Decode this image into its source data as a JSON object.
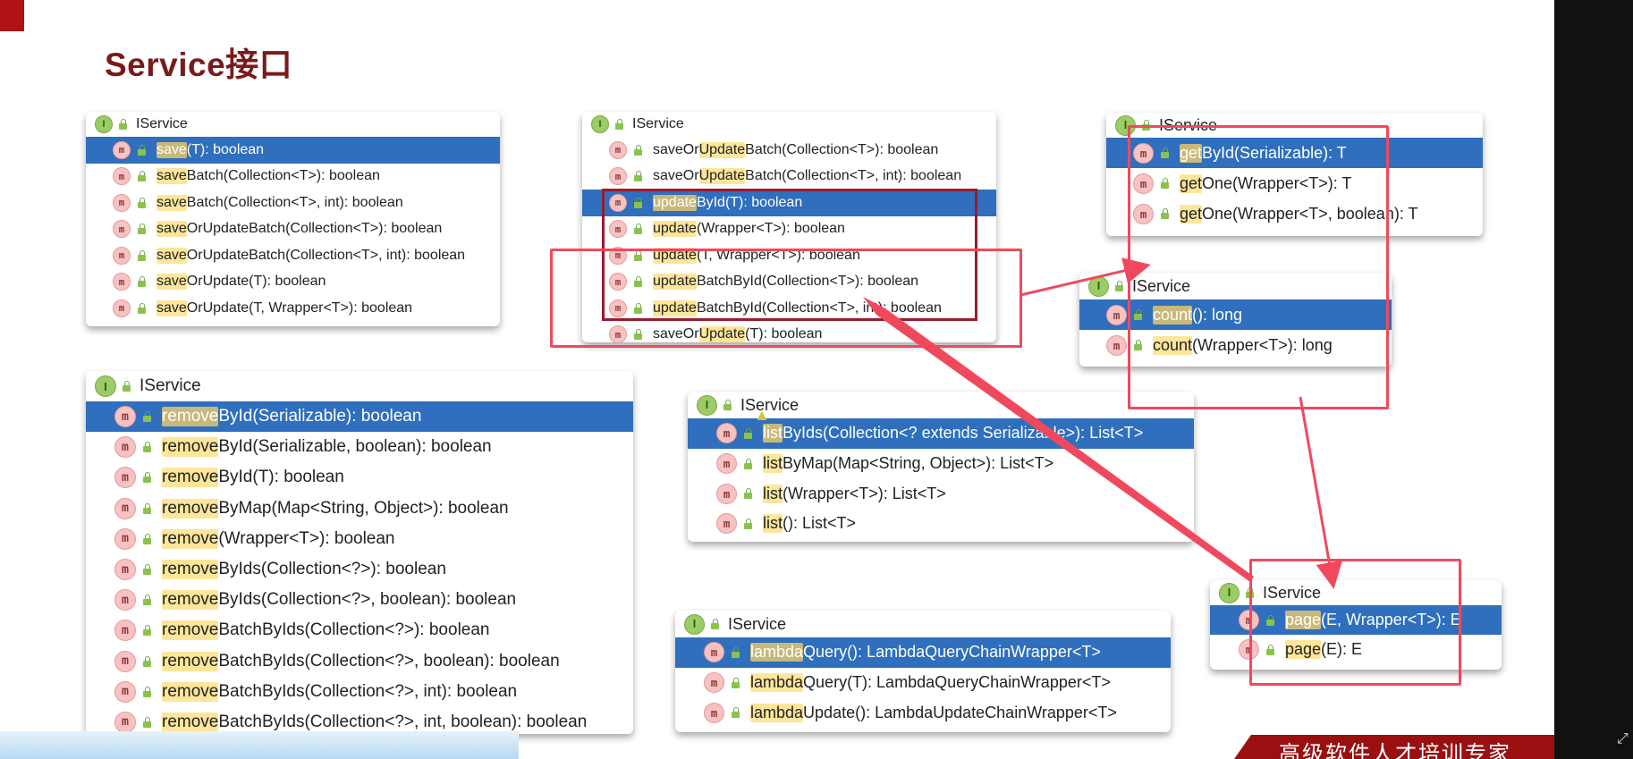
{
  "slide": {
    "title": "Service接口",
    "footer_text": "高级软件人才培训专家"
  },
  "panels": {
    "save": {
      "header": "IService",
      "rows": [
        {
          "hl": "save",
          "rest": "(T): boolean",
          "selected": true
        },
        {
          "hl": "save",
          "rest": "Batch(Collection<T>): boolean"
        },
        {
          "hl": "save",
          "rest": "Batch(Collection<T>, int): boolean"
        },
        {
          "hl": "save",
          "rest": "OrUpdateBatch(Collection<T>): boolean"
        },
        {
          "hl": "save",
          "rest": "OrUpdateBatch(Collection<T>, int): boolean"
        },
        {
          "hl": "save",
          "rest": "OrUpdate(T): boolean"
        },
        {
          "hl": "save",
          "rest": "OrUpdate(T, Wrapper<T>): boolean"
        }
      ]
    },
    "update": {
      "header": "IService",
      "rows": [
        {
          "pre": "saveOr",
          "hl": "Update",
          "rest": "Batch(Collection<T>): boolean"
        },
        {
          "pre": "saveOr",
          "hl": "Update",
          "rest": "Batch(Collection<T>, int): boolean"
        },
        {
          "pre": "",
          "hl": "update",
          "rest": "ById(T): boolean",
          "selected": true
        },
        {
          "pre": "",
          "hl": "update",
          "rest": "(Wrapper<T>): boolean"
        },
        {
          "pre": "",
          "hl": "update",
          "rest": "(T, Wrapper<T>): boolean"
        },
        {
          "pre": "",
          "hl": "update",
          "rest": "BatchById(Collection<T>): boolean"
        },
        {
          "pre": "",
          "hl": "update",
          "rest": "BatchById(Collection<T>, int): boolean"
        },
        {
          "pre": "saveOr",
          "hl": "Update",
          "rest": "(T): boolean"
        }
      ]
    },
    "get": {
      "header": "IService",
      "rows": [
        {
          "hl": "get",
          "rest": "ById(Serializable): T",
          "selected": true
        },
        {
          "hl": "get",
          "rest": "One(Wrapper<T>): T"
        },
        {
          "hl": "get",
          "rest": "One(Wrapper<T>, boolean): T"
        }
      ]
    },
    "count": {
      "header": "IService",
      "rows": [
        {
          "hl": "count",
          "rest": "(): long",
          "selected": true
        },
        {
          "hl": "count",
          "rest": "(Wrapper<T>): long"
        }
      ]
    },
    "remove": {
      "header": "IService",
      "rows": [
        {
          "hl": "remove",
          "rest": "ById(Serializable): boolean",
          "selected": true
        },
        {
          "hl": "remove",
          "rest": "ById(Serializable, boolean): boolean"
        },
        {
          "hl": "remove",
          "rest": "ById(T): boolean"
        },
        {
          "hl": "remove",
          "rest": "ByMap(Map<String, Object>): boolean"
        },
        {
          "hl": "remove",
          "rest": "(Wrapper<T>): boolean"
        },
        {
          "hl": "remove",
          "rest": "ByIds(Collection<?>): boolean"
        },
        {
          "hl": "remove",
          "rest": "ByIds(Collection<?>, boolean): boolean"
        },
        {
          "hl": "remove",
          "rest": "BatchByIds(Collection<?>): boolean"
        },
        {
          "hl": "remove",
          "rest": "BatchByIds(Collection<?>, boolean): boolean"
        },
        {
          "hl": "remove",
          "rest": "BatchByIds(Collection<?>, int): boolean"
        },
        {
          "hl": "remove",
          "rest": "BatchByIds(Collection<?>, int, boolean): boolean"
        }
      ]
    },
    "list": {
      "header": "IService",
      "rows": [
        {
          "hl": "list",
          "rest": "ByIds(Collection<? extends Serializable>): List<T>",
          "selected": true
        },
        {
          "hl": "list",
          "rest": "ByMap(Map<String, Object>): List<T>"
        },
        {
          "hl": "list",
          "rest": "(Wrapper<T>): List<T>"
        },
        {
          "hl": "list",
          "rest": "(): List<T>"
        }
      ]
    },
    "lambda": {
      "header": "IService",
      "rows": [
        {
          "hl": "lambda",
          "rest": "Query(): LambdaQueryChainWrapper<T>",
          "selected": true
        },
        {
          "hl": "lambda",
          "rest": "Query(T): LambdaQueryChainWrapper<T>"
        },
        {
          "hl": "lambda",
          "rest": "Update(): LambdaUpdateChainWrapper<T>"
        }
      ]
    },
    "page": {
      "header": "IService",
      "rows": [
        {
          "hl": "page",
          "rest": "(E, Wrapper<T>): E",
          "selected": true
        },
        {
          "hl": "page",
          "rest": "(E): E"
        }
      ]
    }
  },
  "icons": {
    "interface": "I",
    "method": "m"
  },
  "colors": {
    "selection": "#2f6fbd",
    "highlight": "#fde69a",
    "annotation": "#f0495e",
    "title": "#7a1a1a"
  }
}
